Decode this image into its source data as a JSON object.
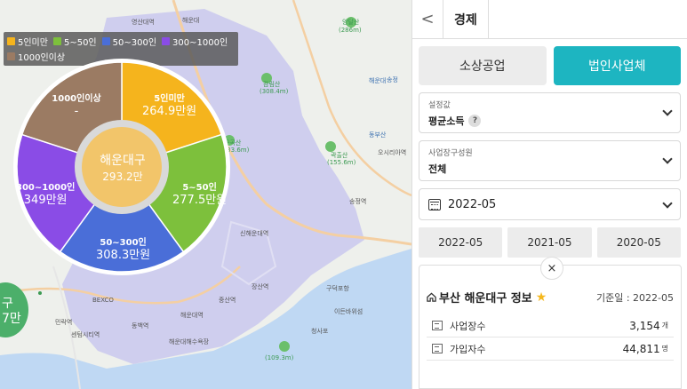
{
  "map": {
    "labels": [
      {
        "t": "영산대역",
        "cls": ""
      },
      {
        "t": "해운대",
        "cls": ""
      },
      {
        "t": "양달산",
        "cls": "green"
      },
      {
        "t": "(286m)",
        "cls": "green"
      },
      {
        "t": "감림산",
        "cls": "green"
      },
      {
        "t": "(308.4m)",
        "cls": "green"
      },
      {
        "t": "해운대",
        "cls": "blue"
      },
      {
        "t": "송정",
        "cls": "blue"
      },
      {
        "t": "구곡산",
        "cls": "green"
      },
      {
        "t": "(333.6m)",
        "cls": "green"
      },
      {
        "t": "동부산",
        "cls": "blue"
      },
      {
        "t": "곽출산",
        "cls": "green"
      },
      {
        "t": "(155.6m)",
        "cls": "green"
      },
      {
        "t": "오시리아역",
        "cls": ""
      },
      {
        "t": "송정역",
        "cls": ""
      },
      {
        "t": "신해운대역",
        "cls": ""
      },
      {
        "t": "중산역",
        "cls": ""
      },
      {
        "t": "장산역",
        "cls": ""
      },
      {
        "t": "구덕포항",
        "cls": ""
      },
      {
        "t": "이든바위섬",
        "cls": ""
      },
      {
        "t": "해운대역",
        "cls": ""
      },
      {
        "t": "청사포",
        "cls": ""
      },
      {
        "t": "BEXCO",
        "cls": ""
      },
      {
        "t": "민락역",
        "cls": ""
      },
      {
        "t": "센텀시티역",
        "cls": ""
      },
      {
        "t": "동백역",
        "cls": ""
      },
      {
        "t": "해운대해수욕장",
        "cls": ""
      },
      {
        "t": "(109.3m)",
        "cls": "green"
      }
    ],
    "region_badge": {
      "l1": "구",
      "l2": "7만"
    }
  },
  "legend": [
    {
      "label": "5인미만",
      "color": "#f5b41d"
    },
    {
      "label": "5~50인",
      "color": "#7dc03c"
    },
    {
      "label": "50~300인",
      "color": "#4a6ed8"
    },
    {
      "label": "300~1000인",
      "color": "#8a4ce6"
    },
    {
      "label": "1000인이상",
      "color": "#9b7b63"
    }
  ],
  "chart_data": {
    "type": "pie",
    "title": "해운대구",
    "center": {
      "name": "해운대구",
      "value": "293.2만"
    },
    "slices": [
      {
        "name": "5인미만",
        "value_text": "264.9만원",
        "value": 264.9,
        "color": "#f5b41d"
      },
      {
        "name": "5~50인",
        "value_text": "277.5만원",
        "value": 277.5,
        "color": "#7dc03c"
      },
      {
        "name": "50~300인",
        "value_text": "308.3만원",
        "value": 308.3,
        "color": "#4a6ed8"
      },
      {
        "name": "300~1000인",
        "value_text": "349만원",
        "value": 349,
        "color": "#8a4ce6"
      },
      {
        "name": "1000인이상",
        "value_text": "-",
        "value": null,
        "color": "#9b7b63"
      }
    ]
  },
  "panel": {
    "back": "<",
    "tab": "경제",
    "seg_small": "소상공업",
    "seg_corp": "법인사업체",
    "setting_label": "설정값",
    "setting_value": "평균소득",
    "help": "?",
    "composition_label": "사업장구성원",
    "composition_value": "전체",
    "date_value": "2022-05",
    "dates": [
      "2022-05",
      "2021-05",
      "2020-05"
    ],
    "close": "×",
    "info_title": "부산 해운대구 정보",
    "star": "★",
    "base_date": "기준일 : 2022-05",
    "rows": [
      {
        "k": "사업장수",
        "v": "3,154",
        "u": "개"
      },
      {
        "k": "가입자수",
        "v": "44,811",
        "u": "명"
      }
    ]
  }
}
